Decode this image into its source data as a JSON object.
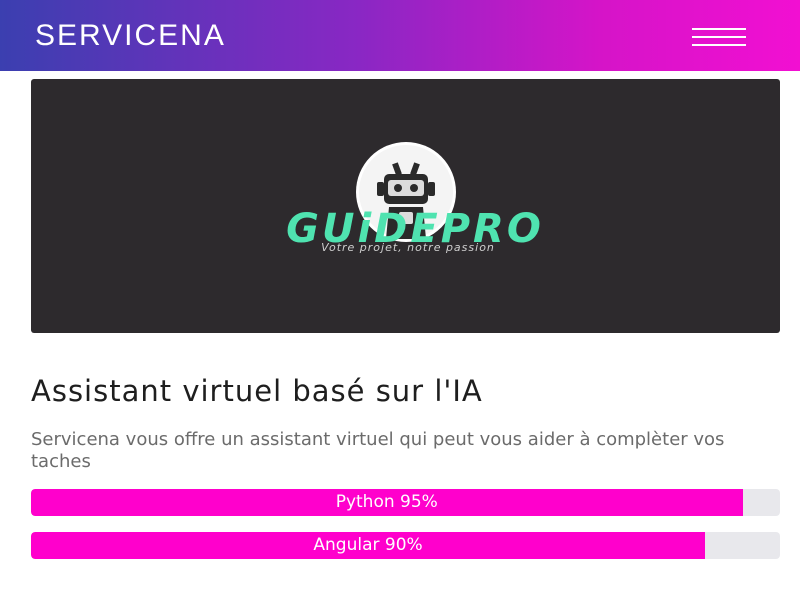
{
  "header": {
    "brand": "SERVICENA",
    "gradient": [
      "#3b3fb0",
      "#f20fd2"
    ]
  },
  "hero": {
    "logo_text": "GUiDEPRO",
    "tagline": "Votre projet, notre passion",
    "background": "#2d2a2d",
    "logo_accent": "#4fe3b0"
  },
  "main": {
    "title": "Assistant virtuel basé sur l'IA",
    "description": "Servicena vous offre un assistant virtuel qui peut vous aider à complèter vos taches"
  },
  "skills": [
    {
      "label": "Python 95%",
      "value": 95
    },
    {
      "label": "Angular 90%",
      "value": 90
    }
  ],
  "colors": {
    "accent": "#ff00cc",
    "track": "#e8e8ec"
  }
}
